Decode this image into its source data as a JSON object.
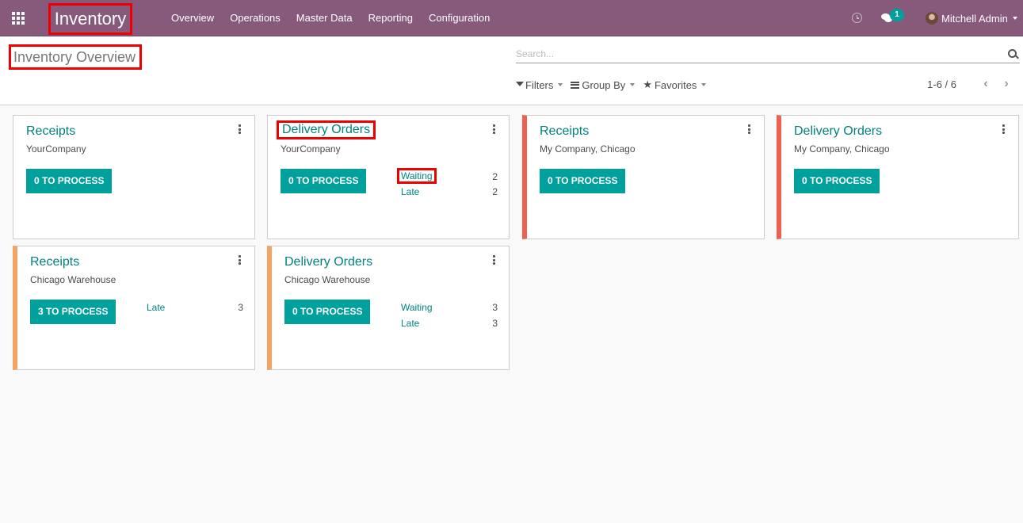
{
  "navbar": {
    "app_title": "Inventory",
    "menu": [
      "Overview",
      "Operations",
      "Master Data",
      "Reporting",
      "Configuration"
    ],
    "messages_badge": "1",
    "user_name": "Mitchell Admin",
    "color": "#875a7b"
  },
  "control_panel": {
    "page_title": "Inventory Overview",
    "search_placeholder": "Search...",
    "filters_label": "Filters",
    "group_by_label": "Group By",
    "favorites_label": "Favorites",
    "pager": "1-6 / 6"
  },
  "cards": [
    {
      "title": "Receipts",
      "subtitle": "YourCompany",
      "button": "0 TO PROCESS",
      "color_tag": "none",
      "stats": []
    },
    {
      "title": "Delivery Orders",
      "subtitle": "YourCompany",
      "button": "0 TO PROCESS",
      "color_tag": "none",
      "stats": [
        {
          "label": "Waiting",
          "value": "2"
        },
        {
          "label": "Late",
          "value": "2"
        }
      ]
    },
    {
      "title": "Receipts",
      "subtitle": "My Company, Chicago",
      "button": "0 TO PROCESS",
      "color_tag": "#f06050",
      "stats": []
    },
    {
      "title": "Delivery Orders",
      "subtitle": "My Company, Chicago",
      "button": "0 TO PROCESS",
      "color_tag": "#f06050",
      "stats": []
    },
    {
      "title": "Receipts",
      "subtitle": "Chicago Warehouse",
      "button": "3 TO PROCESS",
      "color_tag": "#f4a460",
      "stats": [
        {
          "label": "Late",
          "value": "3"
        }
      ]
    },
    {
      "title": "Delivery Orders",
      "subtitle": "Chicago Warehouse",
      "button": "0 TO PROCESS",
      "color_tag": "#f4a460",
      "stats": [
        {
          "label": "Waiting",
          "value": "3"
        },
        {
          "label": "Late",
          "value": "3"
        }
      ]
    }
  ],
  "colors": {
    "accent": "#00a09d",
    "link": "#00827f",
    "highlight_box": "#ee0000"
  }
}
